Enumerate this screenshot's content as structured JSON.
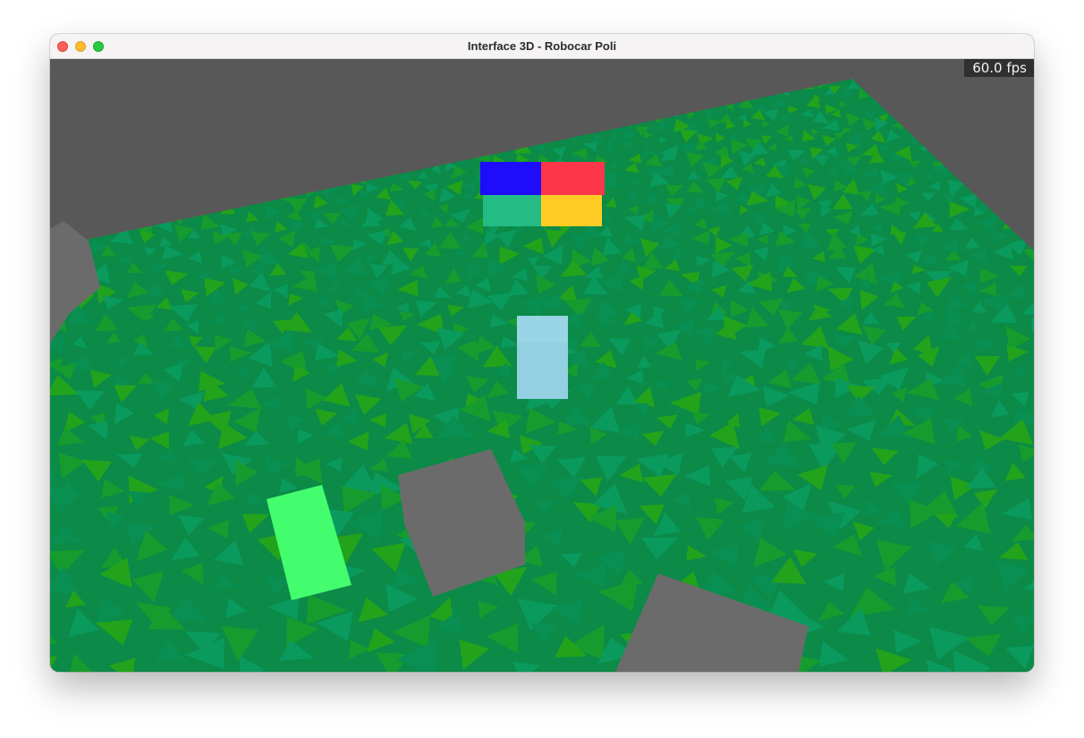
{
  "window": {
    "title": "Interface 3D - Robocar Poli",
    "controls": [
      "close-button",
      "minimize-button",
      "maximize-button"
    ]
  },
  "hud": {
    "fps": "60.0 fps"
  },
  "scene": {
    "background_color": "#585858",
    "ground": {
      "base_color": "#0b8a48",
      "triangle_colors": [
        "#169c2e",
        "#0a9a5e",
        "#23a31c",
        "#098f52"
      ]
    },
    "color_panel": {
      "tiles": [
        {
          "name": "blue",
          "color": "#1d0dfb"
        },
        {
          "name": "red",
          "color": "#fe364a"
        },
        {
          "name": "teal",
          "color": "#25bb84"
        },
        {
          "name": "yellow",
          "color": "#fecb25"
        }
      ]
    },
    "objects": [
      {
        "name": "light-blue-block",
        "color": "#93d0e1"
      },
      {
        "name": "green-block",
        "color": "#43fd6f"
      },
      {
        "name": "gray-cube-center",
        "color": "#6b6b6b"
      },
      {
        "name": "gray-cube-bottom",
        "color": "#6b6b6b"
      },
      {
        "name": "gray-cube-left",
        "color": "#6b6b6b"
      }
    ]
  }
}
